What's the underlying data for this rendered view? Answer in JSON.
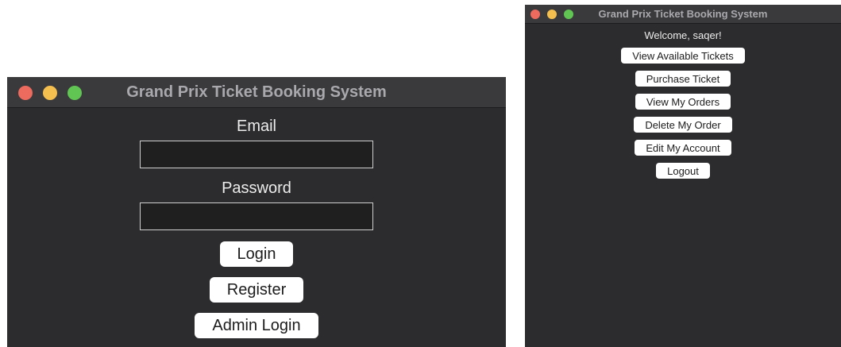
{
  "colors": {
    "traffic_close": "#ed6a5e",
    "traffic_minimize": "#f5bf4f",
    "traffic_maximize": "#61c554"
  },
  "login_window": {
    "title": "Grand Prix Ticket Booking System",
    "email_label": "Email",
    "email_value": "",
    "password_label": "Password",
    "password_value": "",
    "login_label": "Login",
    "register_label": "Register",
    "admin_login_label": "Admin Login"
  },
  "menu_window": {
    "title": "Grand Prix Ticket Booking System",
    "welcome": "Welcome, saqer!",
    "buttons": [
      "View Available Tickets",
      "Purchase Ticket",
      "View My Orders",
      "Delete My Order",
      "Edit My Account",
      "Logout"
    ]
  }
}
